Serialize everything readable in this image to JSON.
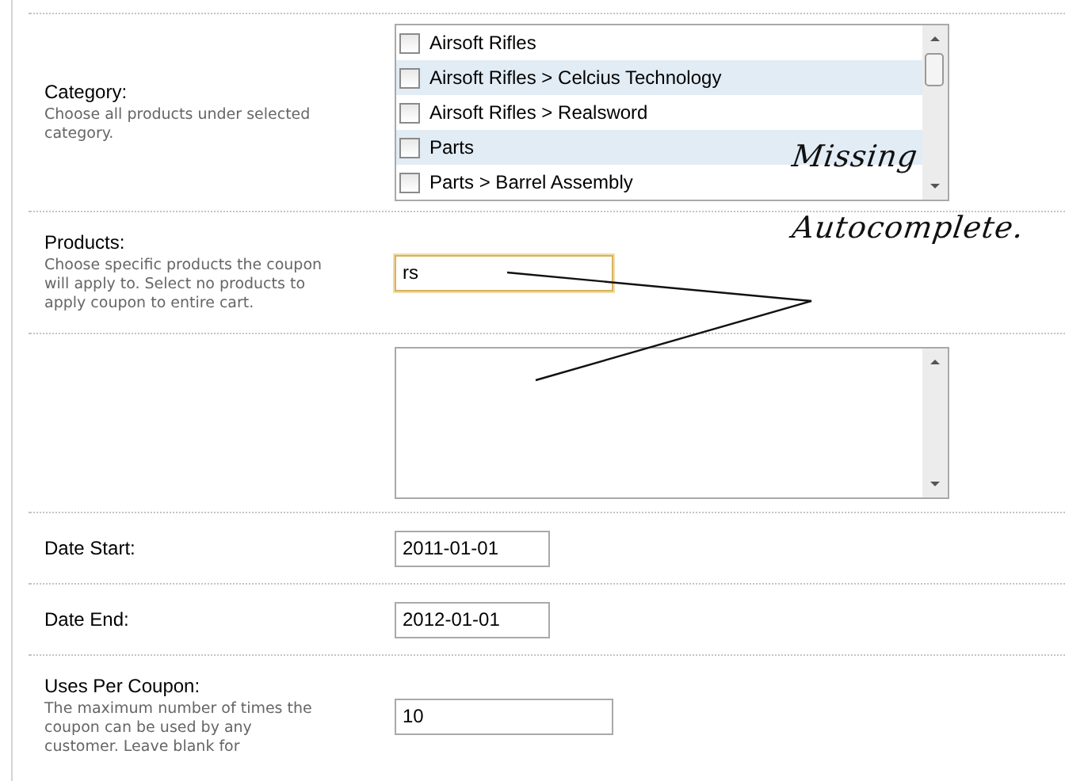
{
  "rows": [
    {
      "kind": "checklist",
      "label": "Category:",
      "description": "Choose all products under selected category.",
      "options": [
        {
          "label": "Airsoft Rifles",
          "checked": false
        },
        {
          "label": "Airsoft Rifles > Celcius Technology",
          "checked": false
        },
        {
          "label": "Airsoft Rifles > Realsword",
          "checked": false
        },
        {
          "label": "Parts",
          "checked": false
        },
        {
          "label": "Parts > Barrel Assembly",
          "checked": false
        }
      ]
    },
    {
      "kind": "text",
      "label": "Products:",
      "description": "Choose specific products the coupon will apply to. Select no products to apply coupon to entire cart.",
      "value": "rs",
      "focused": true
    },
    {
      "kind": "textarea"
    },
    {
      "kind": "date",
      "label": "Date Start:",
      "value": "2011-01-01",
      "focused": false
    },
    {
      "kind": "date",
      "label": "Date End:",
      "value": "2012-01-01",
      "focused": false
    },
    {
      "kind": "text",
      "label": "Uses Per Coupon:",
      "description": "The maximum number of times the coupon can be used by any customer. Leave blank for",
      "value": "10",
      "focused": false
    }
  ],
  "annotation": {
    "lines": [
      "Missing",
      "Autocomplete."
    ]
  }
}
